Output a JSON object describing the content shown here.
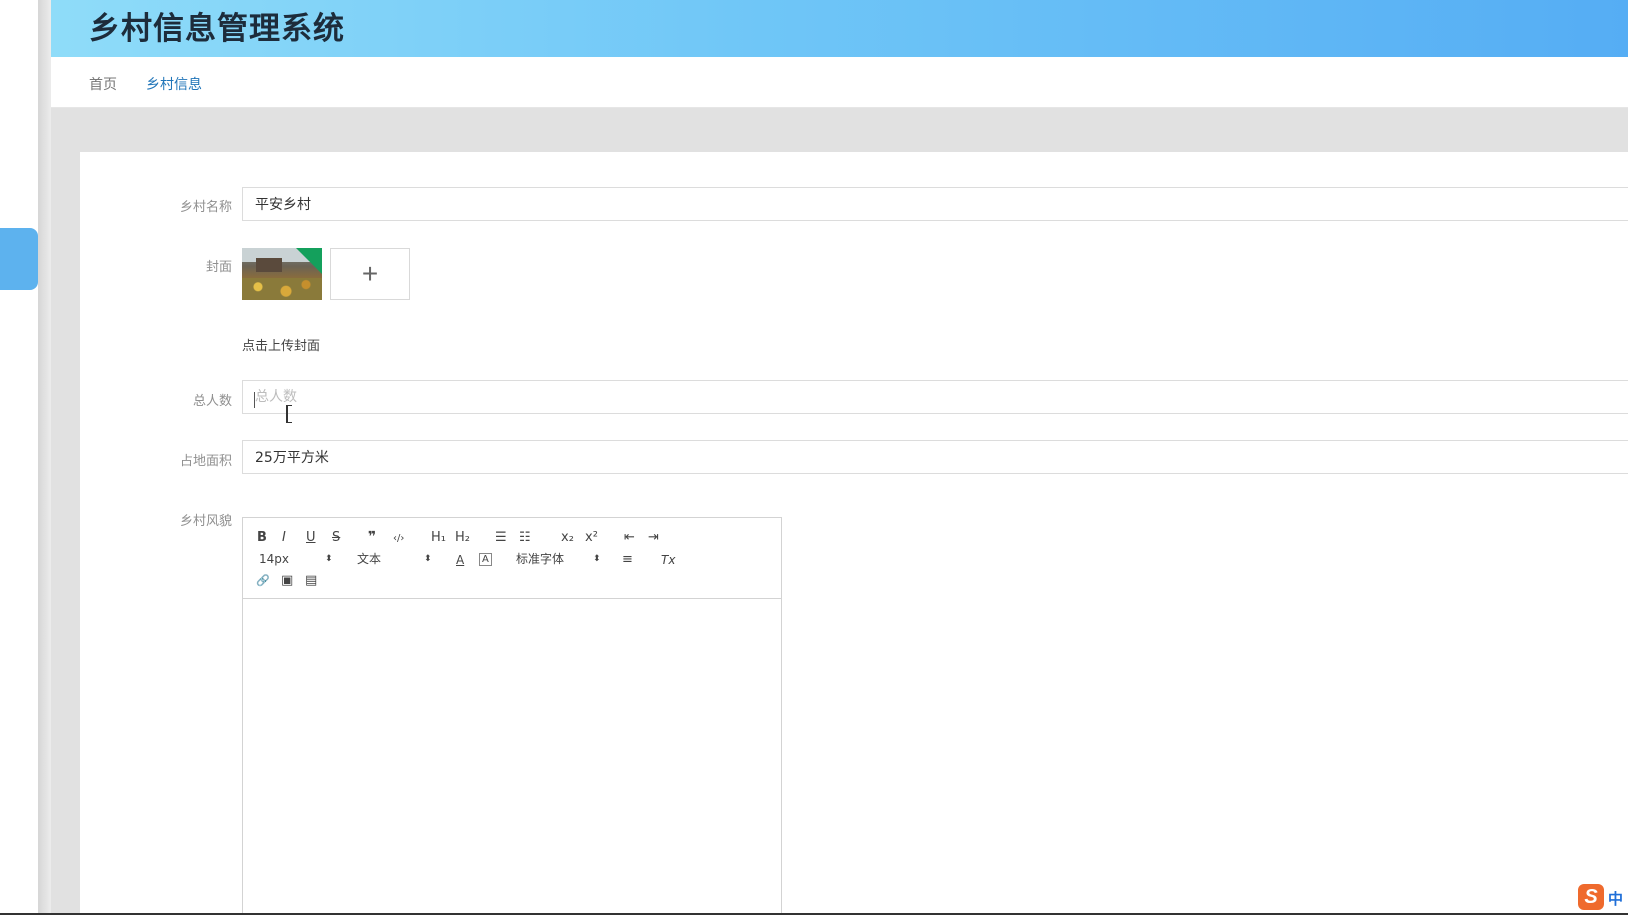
{
  "app": {
    "title": "乡村信息管理系统"
  },
  "breadcrumb": {
    "home": "首页",
    "current": "乡村信息"
  },
  "form": {
    "name_label": "乡村名称",
    "name_value": "平安乡村",
    "cover_label": "封面",
    "cover_upload_icon": "+",
    "cover_tip": "点击上传封面",
    "population_label": "总人数",
    "population_placeholder": "总人数",
    "population_value": "",
    "area_label": "占地面积",
    "area_value": "25万平方米",
    "style_label": "乡村风貌"
  },
  "editor": {
    "bold": "B",
    "italic": "I",
    "underline": "U",
    "strike": "S",
    "blockquote": "❞",
    "code": "‹/›",
    "h1": "H₁",
    "h2": "H₂",
    "ordered_list": "☰",
    "bullet_list": "☷",
    "subscript": "x₂",
    "superscript": "x²",
    "outdent": "⇤",
    "indent": "⇥",
    "font_size": "14px",
    "header_select": "文本",
    "font_color": "A",
    "background_color": "A",
    "font_family": "标准字体",
    "align": "≡",
    "clean": "Tx",
    "link": "🔗",
    "image": "▣",
    "video": "▤"
  },
  "ime": {
    "logo": "S",
    "mode": "中"
  },
  "colors": {
    "header_start": "#8fdcf9",
    "header_end": "#55adf4",
    "breadcrumb_active": "#1f74b8",
    "sidebar_tab": "#5db2ee"
  }
}
